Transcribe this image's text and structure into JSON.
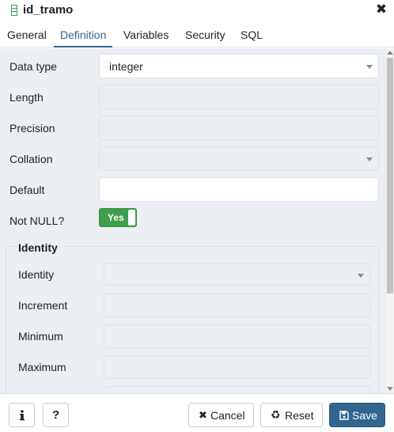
{
  "dialog": {
    "title": "id_tramo",
    "icon": "column-icon",
    "close_icon": "close-icon"
  },
  "tabs": [
    {
      "label": "General"
    },
    {
      "label": "Definition",
      "active": true
    },
    {
      "label": "Variables"
    },
    {
      "label": "Security"
    },
    {
      "label": "SQL"
    }
  ],
  "form": {
    "data_type": {
      "label": "Data type",
      "value": "integer"
    },
    "length": {
      "label": "Length",
      "value": ""
    },
    "precision": {
      "label": "Precision",
      "value": ""
    },
    "collation": {
      "label": "Collation",
      "value": ""
    },
    "default": {
      "label": "Default",
      "value": ""
    },
    "not_null": {
      "label": "Not NULL?",
      "toggle_label": "Yes",
      "state": true
    }
  },
  "identity_section": {
    "legend": "Identity",
    "identity": {
      "label": "Identity",
      "value": ""
    },
    "increment": {
      "label": "Increment",
      "value": ""
    },
    "minimum": {
      "label": "Minimum",
      "value": ""
    },
    "maximum": {
      "label": "Maximum",
      "value": ""
    }
  },
  "footer": {
    "info_icon": "info-icon",
    "help_icon": "help-icon",
    "cancel_label": "Cancel",
    "reset_label": "Reset",
    "save_label": "Save"
  },
  "colors": {
    "accent": "#326690",
    "toggle_on": "#3f9e4b",
    "panel_bg": "#ebeef3"
  }
}
